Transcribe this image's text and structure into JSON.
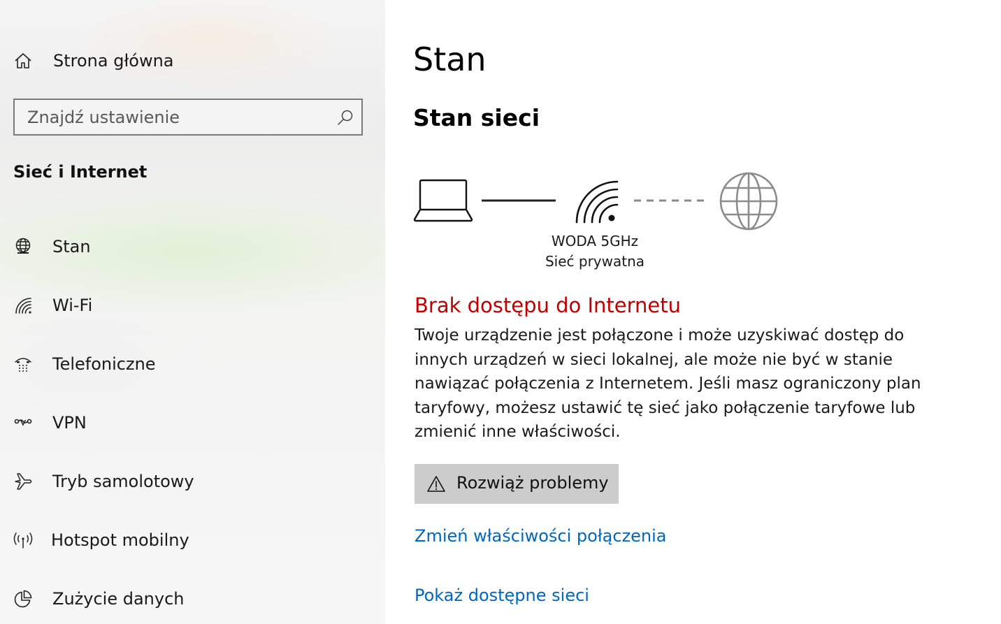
{
  "sidebar": {
    "home_label": "Strona główna",
    "search_placeholder": "Znajdź ustawienie",
    "section_title": "Sieć i Internet",
    "items": [
      {
        "label": "Stan",
        "icon": "globe-status-icon"
      },
      {
        "label": "Wi-Fi",
        "icon": "wifi-icon"
      },
      {
        "label": "Telefoniczne",
        "icon": "dialup-icon"
      },
      {
        "label": "VPN",
        "icon": "vpn-icon"
      },
      {
        "label": "Tryb samolotowy",
        "icon": "airplane-icon"
      },
      {
        "label": "Hotspot mobilny",
        "icon": "hotspot-icon"
      },
      {
        "label": "Zużycie danych",
        "icon": "data-usage-icon"
      }
    ]
  },
  "main": {
    "title": "Stan",
    "subtitle": "Stan sieci",
    "network": {
      "name": "WODA 5GHz",
      "type": "Sieć prywatna"
    },
    "status_heading": "Brak dostępu do Internetu",
    "status_description": "Twoje urządzenie jest połączone i może uzyskiwać dostęp do innych urządzeń w sieci lokalnej, ale może nie być w stanie nawiązać połączenia z Internetem. Jeśli masz ograniczony plan taryfowy, możesz ustawić tę sieć jako połączenie taryfowe lub zmienić inne właściwości.",
    "troubleshoot_label": "Rozwiąż problemy",
    "link_change_properties": "Zmień właściwości połączenia",
    "link_show_networks": "Pokaż dostępne sieci"
  },
  "colors": {
    "error": "#c00000",
    "link": "#0067c0",
    "button_bg": "#cccccc"
  }
}
